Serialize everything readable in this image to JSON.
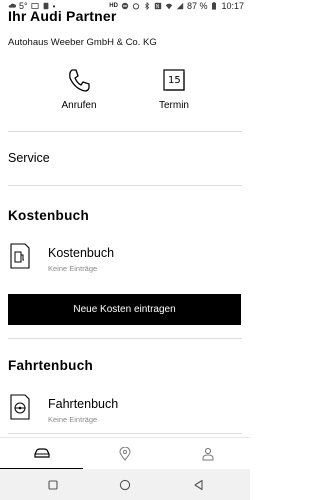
{
  "status_bar": {
    "left_temp": "5°",
    "battery_pct": "87 %",
    "time": "10:17",
    "icons": [
      "cloud-icon",
      "hd-icon",
      "do-not-disturb-icon",
      "alarm-icon",
      "bluetooth-icon",
      "nfc-icon",
      "wifi-icon",
      "signal-icon",
      "battery-icon"
    ]
  },
  "partner": {
    "title": "Ihr Audi Partner",
    "dealer_name": "Autohaus Weeber GmbH & Co. KG",
    "actions": {
      "call": "Anrufen",
      "appointment": "Termin",
      "calendar_day": "15"
    }
  },
  "service": {
    "label": "Service"
  },
  "cost_book": {
    "heading": "Kostenbuch",
    "card_title": "Kostenbuch",
    "card_sub": "Keine Einträge",
    "button": "Neue Kosten eintragen"
  },
  "trip_book": {
    "heading": "Fahrtenbuch",
    "card_title": "Fahrtenbuch",
    "card_sub": "Keine Einträge"
  },
  "bottom_nav": {
    "items": [
      "car-icon",
      "location-pin-icon",
      "person-icon"
    ],
    "active_index": 0
  },
  "system_nav": [
    "recents-square-icon",
    "home-circle-icon",
    "back-triangle-icon"
  ]
}
